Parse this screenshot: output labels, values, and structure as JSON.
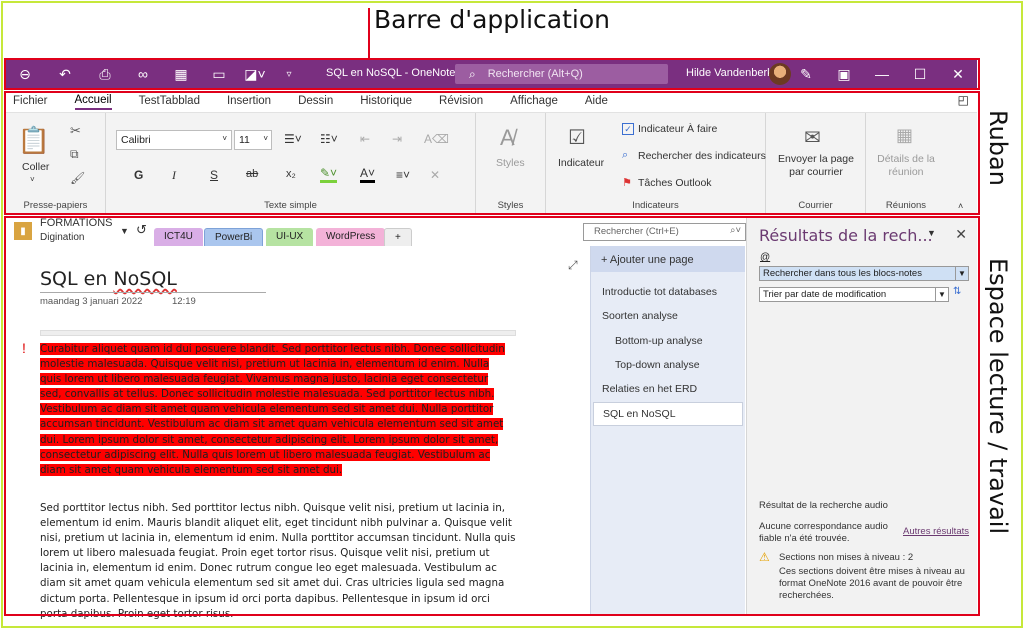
{
  "annotations": {
    "top": "Barre d'application",
    "right_ribbon": "Ruban",
    "right_workspace": "Espace lecture / travail"
  },
  "titlebar": {
    "title": "SQL en NoSQL  -  OneNote",
    "search_placeholder": "Rechercher (Alt+Q)",
    "user": "Hilde Vandenberk"
  },
  "tabs": [
    "Fichier",
    "Accueil",
    "TestTabblad",
    "Insertion",
    "Dessin",
    "Historique",
    "Révision",
    "Affichage",
    "Aide"
  ],
  "ribbon": {
    "clipboard": {
      "paste": "Coller",
      "label": "Presse-papiers"
    },
    "text": {
      "font": "Calibri",
      "size": "11",
      "bold": "G",
      "italic": "I",
      "underline": "S",
      "strike": "ab",
      "subscript": "x₂",
      "label": "Texte simple"
    },
    "styles": {
      "button": "Styles",
      "label": "Styles"
    },
    "tags": {
      "button": "Indicateur",
      "todo": "Indicateur À faire",
      "find": "Rechercher des indicateurs",
      "outlook": "Tâches Outlook",
      "label": "Indicateurs"
    },
    "email": {
      "button": "Envoyer la page par courrier",
      "label": "Courrier"
    },
    "meetings": {
      "button": "Détails de la réunion",
      "label": "Réunions"
    }
  },
  "notebook": {
    "name": "FORMATIONS",
    "sub": "Digination",
    "sections": [
      "ICT4U",
      "PowerBi",
      "UI-UX",
      "WordPress",
      "+"
    ],
    "search_placeholder": "Rechercher (Ctrl+E)"
  },
  "page": {
    "title_a": "SQL",
    "title_b": " en ",
    "title_c": "NoSQL",
    "date": "maandag 3 januari 2022",
    "time": "12:19",
    "red_text": "Curabitur aliquet quam id dui posuere blandit. Sed porttitor lectus nibh. Donec sollicitudin molestie malesuada. Quisque velit nisi, pretium ut lacinia in, elementum id enim. Nulla quis lorem ut libero malesuada feugiat. Vivamus magna justo, lacinia eget consectetur sed, convallis at tellus. Donec sollicitudin molestie malesuada. Sed porttitor lectus nibh. Vestibulum ac diam sit amet quam vehicula elementum sed sit amet dui. Nulla porttitor accumsan tincidunt. Vestibulum ac diam sit amet quam vehicula elementum sed sit amet dui. Lorem ipsum dolor sit amet, consectetur adipiscing elit. Lorem ipsum dolor sit amet, consectetur adipiscing elit. Nulla quis lorem ut libero malesuada feugiat. Vestibulum ac diam sit amet quam vehicula elementum sed sit amet dui.",
    "body_text": "Sed porttitor lectus nibh. Sed porttitor lectus nibh. Quisque velit nisi, pretium ut lacinia in, elementum id enim. Mauris blandit aliquet elit, eget tincidunt nibh pulvinar a. Quisque velit nisi, pretium ut lacinia in, elementum id enim. Nulla porttitor accumsan tincidunt. Nulla quis lorem ut libero malesuada feugiat. Proin eget tortor risus. Quisque velit nisi, pretium ut lacinia in, elementum id enim. Donec rutrum congue leo eget malesuada. Vestibulum ac diam sit amet quam vehicula elementum sed sit amet dui. Cras ultricies ligula sed magna dictum porta. Pellentesque in ipsum id orci porta dapibus. Pellentesque in ipsum id orci porta dapibus. Proin eget tortor risus."
  },
  "pages": {
    "add": "Ajouter une page",
    "items": [
      "Introductie tot databases",
      "Soorten analyse",
      "Bottom-up analyse",
      "Top-down analyse",
      "Relaties en het ERD",
      "SQL en NoSQL"
    ]
  },
  "results": {
    "title": "Résultats de la rech...",
    "query": "@",
    "scope": "Rechercher dans tous les blocs-notes",
    "sort": "Trier par date de modification",
    "audio_title": "Résultat de la recherche audio",
    "audio_none": "Aucune correspondance audio fiable n'a été trouvée.",
    "more": "Autres résultats",
    "unupgraded": "Sections non mises à niveau : 2",
    "unupgraded_desc": "Ces sections doivent être mises à niveau au format OneNote 2016 avant de pouvoir être recherchées."
  },
  "colors": {
    "app_purple": "#7a2f80",
    "highlight_red": "#ff0000",
    "frame_green": "#c6e83a",
    "box_red": "#e0001b"
  }
}
